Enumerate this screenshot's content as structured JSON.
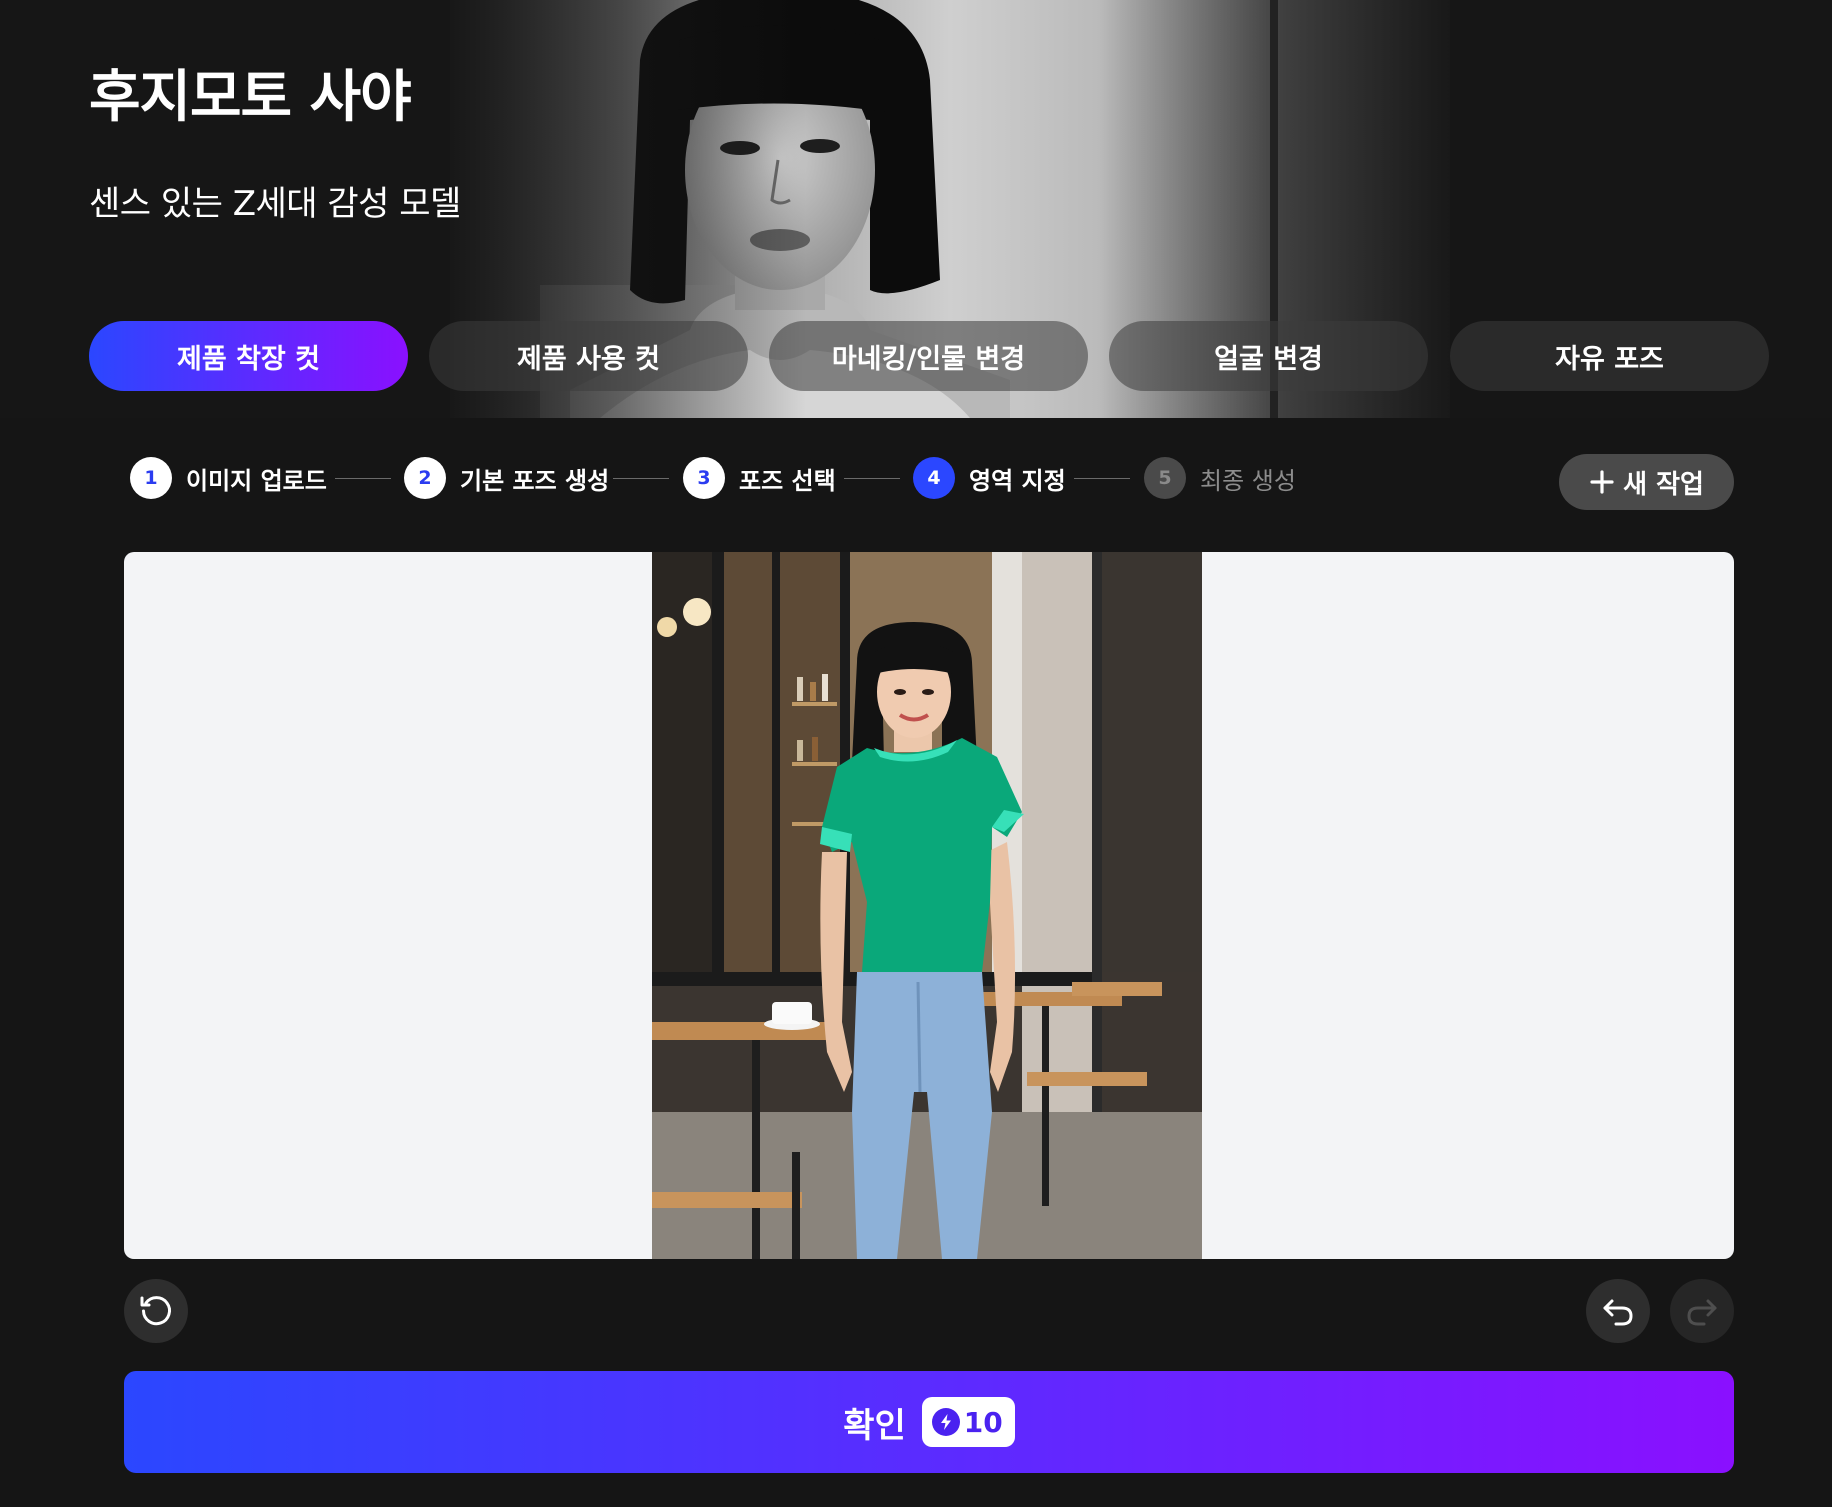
{
  "hero": {
    "title": "후지모토 사야",
    "subtitle": "센스 있는 Z세대 감성 모델"
  },
  "tabs": [
    {
      "label": "제품 착장 컷",
      "active": true
    },
    {
      "label": "제품 사용 컷",
      "active": false
    },
    {
      "label": "마네킹/인물 변경",
      "active": false
    },
    {
      "label": "얼굴 변경",
      "active": false
    },
    {
      "label": "자유 포즈",
      "active": false
    }
  ],
  "steps": [
    {
      "num": "1",
      "label": "이미지 업로드",
      "state": "done"
    },
    {
      "num": "2",
      "label": "기본 포즈 생성",
      "state": "done"
    },
    {
      "num": "3",
      "label": "포즈 선택",
      "state": "done"
    },
    {
      "num": "4",
      "label": "영역 지정",
      "state": "current"
    },
    {
      "num": "5",
      "label": "최종 생성",
      "state": "pending"
    }
  ],
  "new_task": {
    "label": "새 작업",
    "icon": "plus-icon"
  },
  "controls": {
    "reset_icon": "reset-icon",
    "undo_icon": "undo-icon",
    "redo_icon": "redo-icon"
  },
  "confirm": {
    "label": "확인",
    "credits": "10",
    "credit_icon": "lightning-icon"
  },
  "colors": {
    "accent_start": "#2b47ff",
    "accent_end": "#8a10ff",
    "mask_color": "#0aa87a",
    "background": "#151515"
  }
}
